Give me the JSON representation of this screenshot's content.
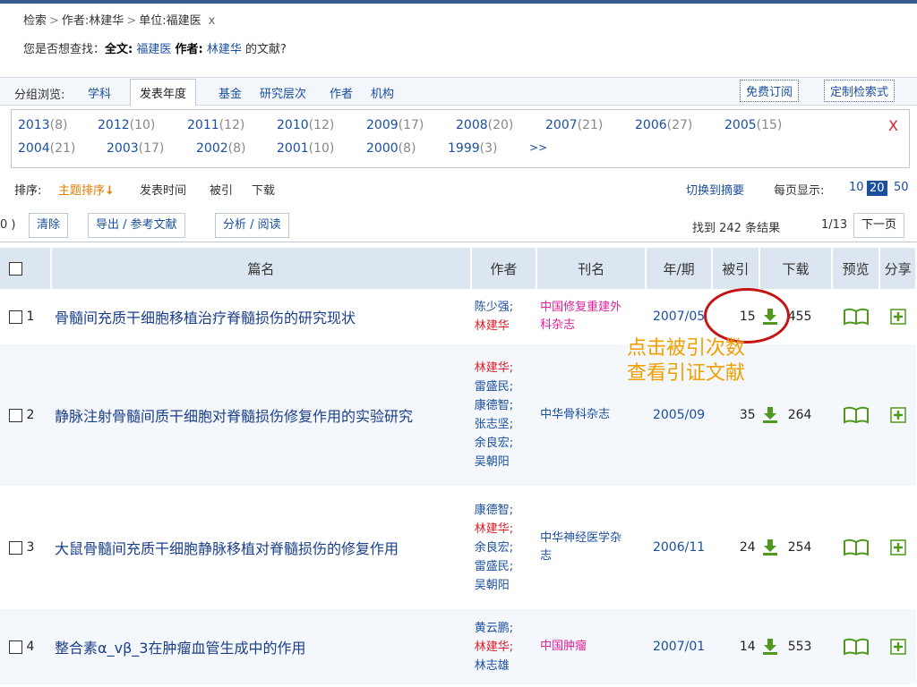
{
  "breadcrumb": {
    "items": [
      "检索",
      "作者:林建华",
      "单位:福建医"
    ],
    "close": "x"
  },
  "suggest": {
    "prefix": "您是否想查找：",
    "fulltext_label": "全文:",
    "fulltext_value": "福建医",
    "author_label": "作者:",
    "author_value": "林建华",
    "suffix": "的文献?"
  },
  "group": {
    "label": "分组浏览:",
    "tabs": [
      "学科",
      "发表年度",
      "基金",
      "研究层次",
      "作者",
      "机构"
    ],
    "active": "发表年度",
    "free_sub": "免费订阅",
    "custom_expr": "定制检索式"
  },
  "years": {
    "row1": [
      {
        "y": "2013",
        "c": "(8)"
      },
      {
        "y": "2012",
        "c": "(10)"
      },
      {
        "y": "2011",
        "c": "(12)"
      },
      {
        "y": "2010",
        "c": "(12)"
      },
      {
        "y": "2009",
        "c": "(17)"
      },
      {
        "y": "2008",
        "c": "(20)"
      },
      {
        "y": "2007",
        "c": "(21)"
      },
      {
        "y": "2006",
        "c": "(27)"
      },
      {
        "y": "2005",
        "c": "(15)"
      }
    ],
    "row2": [
      {
        "y": "2004",
        "c": "(21)"
      },
      {
        "y": "2003",
        "c": "(17)"
      },
      {
        "y": "2002",
        "c": "(8)"
      },
      {
        "y": "2001",
        "c": "(10)"
      },
      {
        "y": "2000",
        "c": "(8)"
      },
      {
        "y": "1999",
        "c": "(3)"
      }
    ],
    "more": ">>",
    "close": "X"
  },
  "sort": {
    "label": "排序:",
    "options": [
      "主题排序",
      "发表时间",
      "被引",
      "下载"
    ],
    "active": "主题排序",
    "arrow": "↓",
    "switch": "切换到摘要",
    "per_page_label": "每页显示:",
    "per_page": [
      "10",
      "20",
      "50"
    ],
    "per_page_active": "20"
  },
  "toolbar": {
    "count_prefix": "0 )",
    "clear": "清除",
    "export": "导出 / 参考文献",
    "analyze": "分析 / 阅读",
    "found": "找到 242 条结果",
    "page": "1/13",
    "next": "下一页"
  },
  "table": {
    "headers": [
      "篇名",
      "作者",
      "刊名",
      "年/期",
      "被引",
      "下载",
      "预览",
      "分享"
    ],
    "rows": [
      {
        "no": "1",
        "title": "骨髓间充质干细胞移植治疗脊髓损伤的研究现状",
        "authors": [
          "陈少强;",
          "林建华"
        ],
        "me": [
          false,
          true
        ],
        "journal": "中国修复重建外科杂志",
        "jpink": true,
        "year": "2007/05",
        "cite": "15",
        "dl": "455"
      },
      {
        "no": "2",
        "title": "静脉注射骨髓间质干细胞对脊髓损伤修复作用的实验研究",
        "authors": [
          "林建华;",
          "雷盛民;",
          "康德智;",
          "张志坚;",
          "余良宏;",
          "吴朝阳"
        ],
        "me": [
          true,
          false,
          false,
          false,
          false,
          false
        ],
        "journal": "中华骨科杂志",
        "jpink": false,
        "year": "2005/09",
        "cite": "35",
        "dl": "264"
      },
      {
        "no": "3",
        "title": "大鼠骨髓间充质干细胞静脉移植对脊髓损伤的修复作用",
        "authors": [
          "康德智;",
          "林建华;",
          "余良宏;",
          "雷盛民;",
          "吴朝阳"
        ],
        "me": [
          false,
          true,
          false,
          false,
          false
        ],
        "journal": "中华神经医学杂志",
        "jpink": false,
        "year": "2006/11",
        "cite": "24",
        "dl": "254"
      },
      {
        "no": "4",
        "title": "整合素α_vβ_3在肿瘤血管生成中的作用",
        "authors": [
          "黄云鹏;",
          "林建华;",
          "林志雄"
        ],
        "me": [
          false,
          true,
          false
        ],
        "journal": "中国肿瘤",
        "jpink": true,
        "year": "2007/01",
        "cite": "14",
        "dl": "553"
      }
    ]
  },
  "callout": {
    "line1": "点击被引次数",
    "line2": "查看引证文献"
  },
  "colors": {
    "link": "#1a4fa0",
    "author_highlight": "#d8202a",
    "journal_pink": "#e0209a",
    "sort_active": "#e57b00",
    "callout": "#f0a000",
    "ring": "#c41414"
  }
}
